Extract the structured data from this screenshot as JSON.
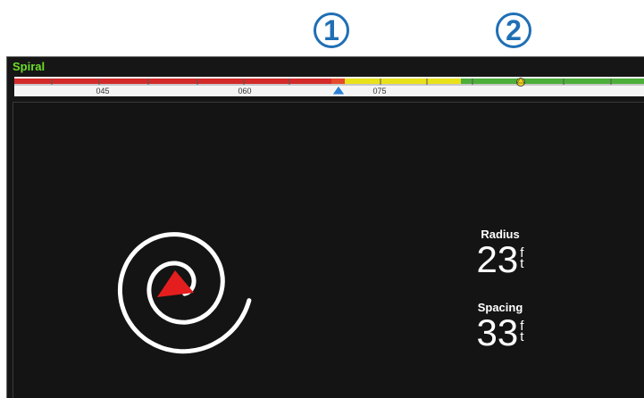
{
  "callouts": {
    "one": "1",
    "two": "2"
  },
  "mode": {
    "title": "Spiral"
  },
  "heading": {
    "ticks": [
      {
        "label": "045",
        "value": 45
      },
      {
        "label": "060",
        "value": 60
      },
      {
        "label": "075",
        "value": 75
      }
    ],
    "zones": {
      "left": "#d42a2a",
      "mid": "#e9e21a",
      "right": "#4caf3a"
    }
  },
  "radius": {
    "label": "Radius",
    "value": "23",
    "unit_top": "f",
    "unit_bottom": "t"
  },
  "spacing": {
    "label": "Spacing",
    "value": "33",
    "unit_top": "f",
    "unit_bottom": "t"
  },
  "icons": {
    "boat": "red-triangle-boat-icon",
    "current_heading": "blue-triangle-marker-icon",
    "target_heading": "yellow-waypoint-marker-icon"
  }
}
